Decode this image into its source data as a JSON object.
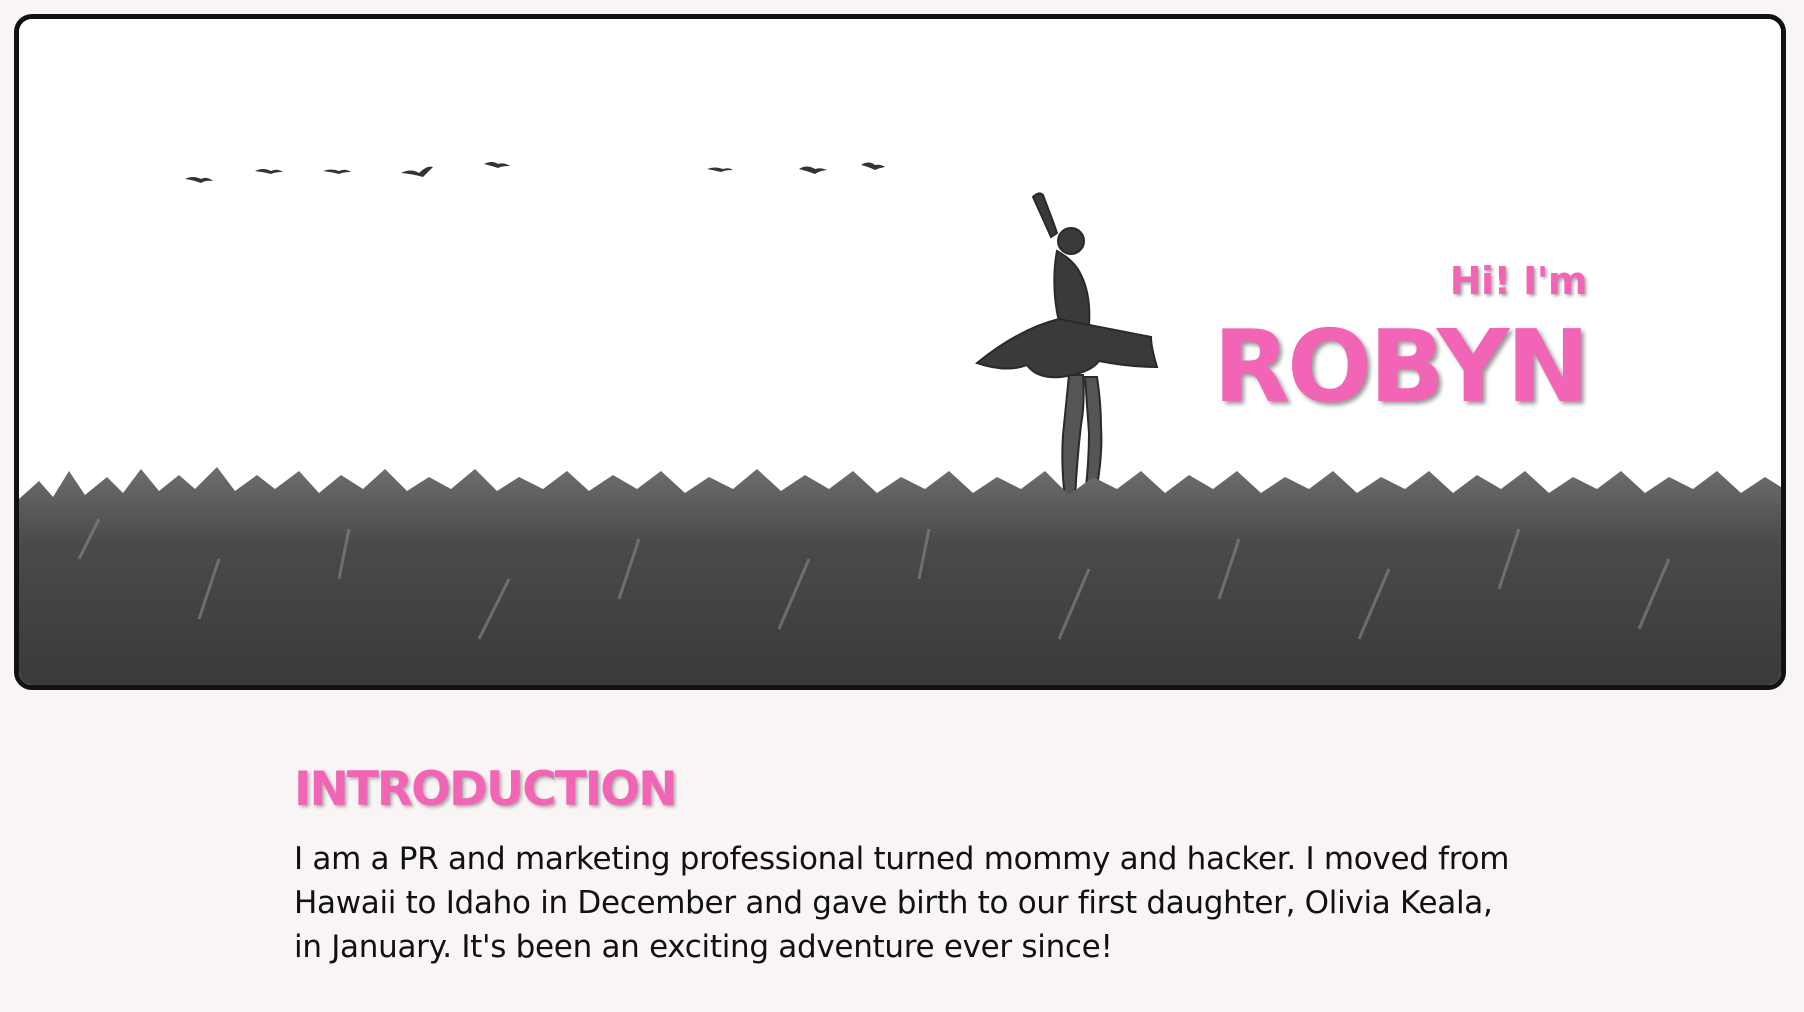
{
  "hero": {
    "greeting": "Hi! I'm",
    "name": "ROBYN",
    "image_description_icon": "ballerina-in-field-photo"
  },
  "intro": {
    "title": "INTRODUCTION",
    "text": "I am a PR and marketing professional turned mommy and hacker. I moved from Hawaii to Idaho in December and gave birth to our first daughter, Olivia Keala, in January. It's been an exciting adventure ever since!"
  },
  "colors": {
    "accent": "#f265b6",
    "page_background": "#f8f5f4",
    "frame_border": "#111111"
  }
}
